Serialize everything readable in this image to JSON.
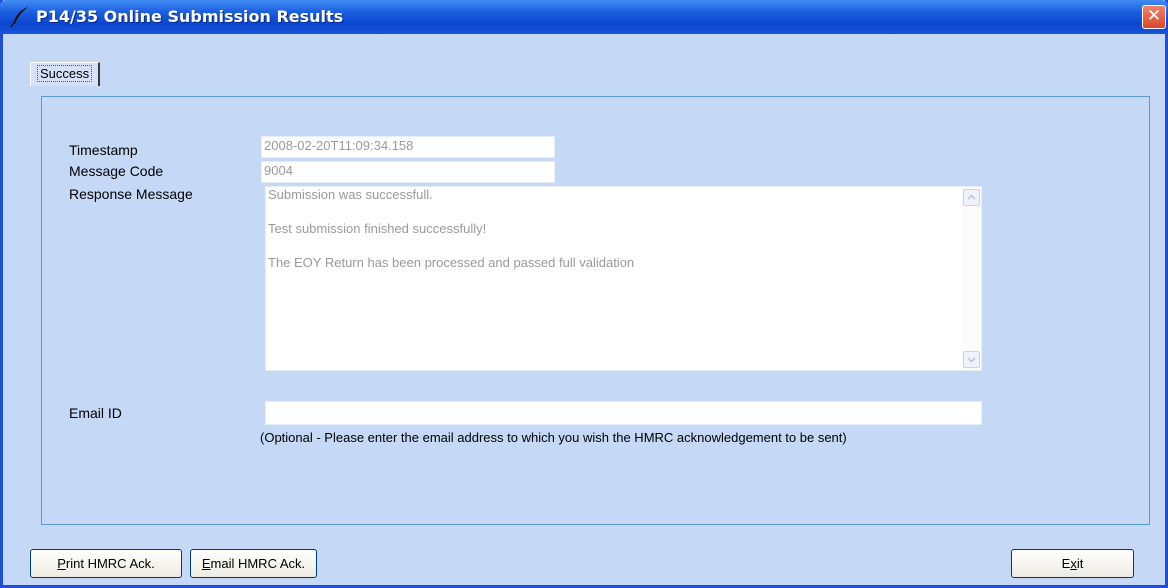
{
  "window": {
    "title": "P14/35 Online Submission Results",
    "close_glyph": "✕"
  },
  "tabs": [
    {
      "label": "Success",
      "selected": true
    }
  ],
  "fields": {
    "timestamp": {
      "label": "Timestamp",
      "value": "2008-02-20T11:09:34.158"
    },
    "message_code": {
      "label": "Message Code",
      "value": "9004"
    },
    "response_message": {
      "label": "Response Message",
      "lines": [
        "Submission was successfull.",
        "Test submission finished successfully!",
        "The EOY Return has been processed and passed full validation"
      ]
    },
    "email_id": {
      "label": "Email ID",
      "value": "",
      "note": "(Optional - Please enter the email address to which you wish the HMRC acknowledgement to be sent)"
    }
  },
  "buttons": {
    "print_ack": {
      "label_first": "P",
      "label_rest": "rint HMRC Ack."
    },
    "email_ack": {
      "label_first": "E",
      "label_rest": "mail HMRC Ack."
    },
    "exit": {
      "label_first": "E",
      "label_mid": "x",
      "label_rest": "it"
    }
  },
  "colors": {
    "window_bg": "#c5d8f6",
    "titlebar": "#0a46d0",
    "close_button": "#d9462a",
    "disabled_text": "#9a9a9a"
  },
  "icons": {
    "title": "feather-quill-icon",
    "close": "close-icon",
    "scroll_up": "chevron-up-icon",
    "scroll_down": "chevron-down-icon"
  }
}
